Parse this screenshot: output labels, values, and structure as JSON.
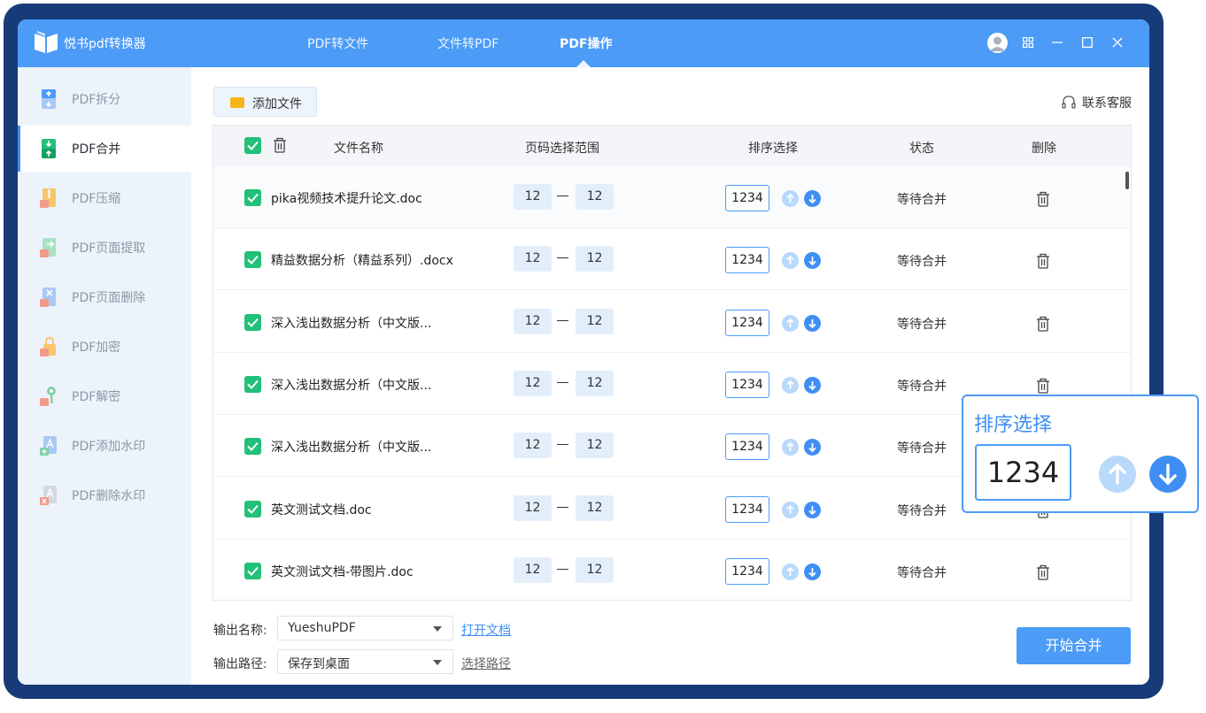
{
  "app": {
    "title": "悦书pdf转换器"
  },
  "nav": {
    "tabs": [
      "PDF转文件",
      "文件转PDF",
      "PDF操作"
    ],
    "active": "PDF操作"
  },
  "sidebar": {
    "items": [
      {
        "label": "PDF拆分",
        "icon": "split-icon"
      },
      {
        "label": "PDF合并",
        "icon": "merge-icon"
      },
      {
        "label": "PDF压缩",
        "icon": "compress-icon"
      },
      {
        "label": "PDF页面提取",
        "icon": "extract-page-icon"
      },
      {
        "label": "PDF页面删除",
        "icon": "delete-page-icon"
      },
      {
        "label": "PDF加密",
        "icon": "encrypt-icon"
      },
      {
        "label": "PDF解密",
        "icon": "decrypt-icon"
      },
      {
        "label": "PDF添加水印",
        "icon": "add-watermark-icon"
      },
      {
        "label": "PDF删除水印",
        "icon": "remove-watermark-icon"
      }
    ],
    "active": "PDF合并"
  },
  "toolbar": {
    "add_file": "添加文件",
    "service": "联系客服"
  },
  "table": {
    "headers": {
      "name": "文件名称",
      "range": "页码选择范围",
      "order": "排序选择",
      "status": "状态",
      "delete": "删除"
    },
    "rows": [
      {
        "name": "pika视频技术提升论文.doc",
        "from": "12",
        "to": "12",
        "order": "1234",
        "status": "等待合并"
      },
      {
        "name": "精益数据分析（精益系列）.docx",
        "from": "12",
        "to": "12",
        "order": "1234",
        "status": "等待合并"
      },
      {
        "name": "深入浅出数据分析（中文版...",
        "from": "12",
        "to": "12",
        "order": "1234",
        "status": "等待合并"
      },
      {
        "name": "深入浅出数据分析（中文版...",
        "from": "12",
        "to": "12",
        "order": "1234",
        "status": "等待合并"
      },
      {
        "name": "深入浅出数据分析（中文版...",
        "from": "12",
        "to": "12",
        "order": "1234",
        "status": "等待合并"
      },
      {
        "name": "英文测试文档.doc",
        "from": "12",
        "to": "12",
        "order": "1234",
        "status": "等待合并"
      },
      {
        "name": "英文测试文档-带图片.doc",
        "from": "12",
        "to": "12",
        "order": "1234",
        "status": "等待合并"
      }
    ]
  },
  "footer": {
    "output_name_label": "输出名称:",
    "output_name_value": "YueshuPDF",
    "open_doc": "打开文档",
    "output_path_label": "输出路径:",
    "output_path_value": "保存到桌面",
    "choose_path": "选择路径",
    "start": "开始合并"
  },
  "callout": {
    "title": "排序选择",
    "value": "1234"
  },
  "colors": {
    "brand": "#4b9bf7",
    "frame": "#173a78",
    "check": "#22c078",
    "link": "#3f8ef3"
  }
}
